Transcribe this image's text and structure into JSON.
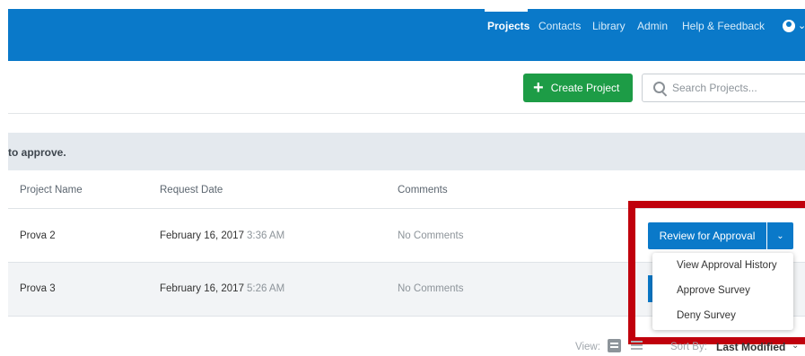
{
  "header": {
    "nav": [
      "Projects",
      "Contacts",
      "Library",
      "Admin",
      "Help & Feedback"
    ],
    "active": "Projects"
  },
  "toolbar": {
    "create_label": "Create Project",
    "search_placeholder": "Search Projects..."
  },
  "notice": {
    "text": "to approve."
  },
  "table": {
    "columns": [
      "Project Name",
      "Request Date",
      "Comments"
    ],
    "rows": [
      {
        "name": "Prova 2",
        "date": "February 16, 2017",
        "time": "3:36 AM",
        "comments": "No Comments"
      },
      {
        "name": "Prova 3",
        "date": "February 16, 2017",
        "time": "5:26 AM",
        "comments": "No Comments"
      }
    ]
  },
  "actions": {
    "review_label": "Review for Approval",
    "menu": [
      "View Approval History",
      "Approve Survey",
      "Deny Survey"
    ]
  },
  "footer": {
    "view_label": "View:",
    "sort_label": "Sort By:",
    "sort_value": "Last Modified"
  },
  "colors": {
    "header": "#0a79c9",
    "create": "#1d9c46",
    "highlight": "#c0000c"
  }
}
